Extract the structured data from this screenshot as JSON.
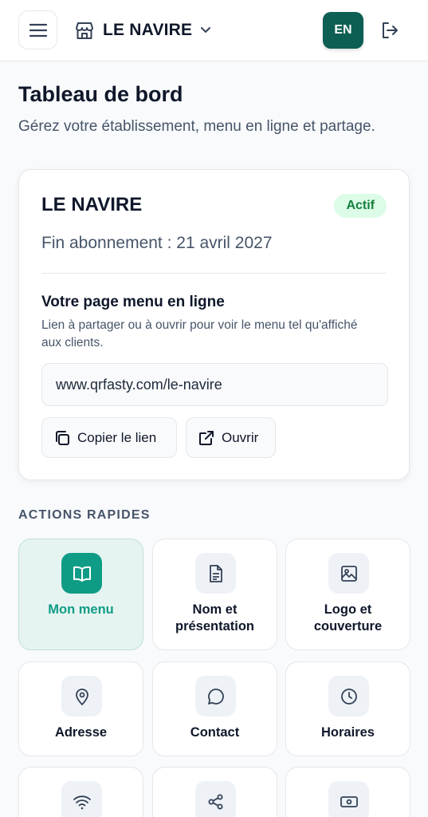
{
  "header": {
    "store_name": "LE NAVIRE",
    "lang": "EN"
  },
  "page": {
    "title": "Tableau de bord",
    "subtitle": "Gérez votre établissement, menu en ligne et partage."
  },
  "card": {
    "name": "LE NAVIRE",
    "status": "Actif",
    "subscription_end": "Fin abonnement : 21 avril 2027",
    "online_title": "Votre page menu en ligne",
    "online_desc": "Lien à partager ou à ouvrir pour voir le menu tel qu'affiché aux clients.",
    "url": "www.qrfasty.com/le-navire",
    "copy_label": "Copier le lien",
    "open_label": "Ouvrir"
  },
  "quick_actions": {
    "label": "ACTIONS RAPIDES",
    "tiles": [
      {
        "label": "Mon menu",
        "icon": "book-icon",
        "active": true
      },
      {
        "label": "Nom et présentation",
        "icon": "document-icon"
      },
      {
        "label": "Logo et couverture",
        "icon": "image-icon"
      },
      {
        "label": "Adresse",
        "icon": "map-pin-icon"
      },
      {
        "label": "Contact",
        "icon": "chat-icon"
      },
      {
        "label": "Horaires",
        "icon": "clock-icon"
      },
      {
        "label": "",
        "icon": "wifi-icon"
      },
      {
        "label": "",
        "icon": "share-icon"
      },
      {
        "label": "",
        "icon": "banknote-icon"
      }
    ]
  },
  "colors": {
    "brand": "#0f9c86",
    "lang_button": "#0d5f53",
    "status_bg": "#dcfce7",
    "status_text": "#15803d"
  }
}
